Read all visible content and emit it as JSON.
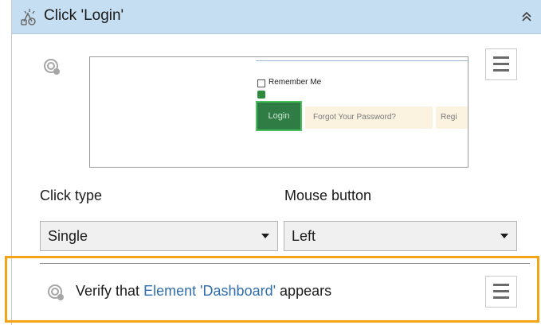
{
  "step": {
    "title": "Click 'Login'",
    "collapse_icon": "double-chevron-up-icon"
  },
  "preview": {
    "remember_me": "Remember Me",
    "login_button": "Login",
    "forgot_link": "Forgot Your Password?",
    "register_link": "Regi"
  },
  "fields": {
    "click_type_label": "Click type",
    "click_type_value": "Single",
    "mouse_button_label": "Mouse button",
    "mouse_button_value": "Left"
  },
  "verify": {
    "prefix": "Verify that",
    "element": "Element 'Dashboard'",
    "suffix": "appears"
  },
  "colors": {
    "header_bg": "#c6def1",
    "highlight": "#f5a417",
    "link": "#2f6dab"
  }
}
